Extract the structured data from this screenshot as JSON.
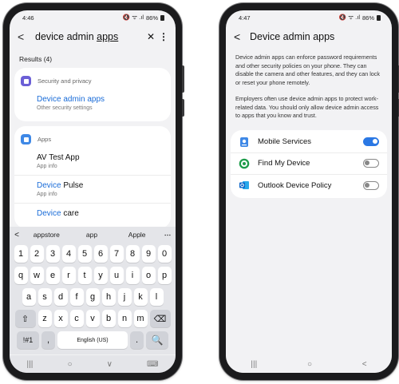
{
  "left": {
    "status": {
      "time": "4:46",
      "icons": "🔇 ᯤ .ıl",
      "battery": "86%"
    },
    "search": {
      "query_prefix": "device admin ",
      "query_underlined": "apps",
      "back": "<",
      "clear": "✕",
      "more": "⋮"
    },
    "results_label": "Results (4)",
    "groups": [
      {
        "category": "Security and privacy",
        "icon": "shield-icon",
        "color": "#6b5fd6",
        "items": [
          {
            "highlight": "Device admin apps",
            "rest": "",
            "subtitle": "Other security settings"
          }
        ]
      },
      {
        "category": "Apps",
        "icon": "apps-grid-icon",
        "color": "#3e88e6",
        "items": [
          {
            "highlight": "",
            "rest": "AV Test App",
            "subtitle": "App info"
          },
          {
            "highlight": "Device",
            "rest": " Pulse",
            "subtitle": "App info"
          },
          {
            "highlight": "Device",
            "rest": " care",
            "subtitle": ""
          }
        ]
      }
    ],
    "suggestions": {
      "chevron": "<",
      "items": [
        "appstore",
        "app",
        "Apple"
      ],
      "more": "⋯"
    },
    "keyboard": {
      "row1": [
        "1",
        "2",
        "3",
        "4",
        "5",
        "6",
        "7",
        "8",
        "9",
        "0"
      ],
      "row2": [
        "q",
        "w",
        "e",
        "r",
        "t",
        "y",
        "u",
        "i",
        "o",
        "p"
      ],
      "row3": [
        "a",
        "s",
        "d",
        "f",
        "g",
        "h",
        "j",
        "k",
        "l"
      ],
      "row4": [
        "⇧",
        "z",
        "x",
        "c",
        "v",
        "b",
        "n",
        "m",
        "⌫"
      ],
      "row5": [
        "!#1",
        ",",
        "English (US)",
        ".",
        "🔍"
      ]
    },
    "navbar": [
      "|||",
      "○",
      "∨",
      "⌨"
    ]
  },
  "right": {
    "status": {
      "time": "4:47",
      "icons": "🔇 ᯤ .ıl",
      "battery": "86%"
    },
    "header": {
      "back": "<",
      "title": "Device admin apps"
    },
    "para1": "Device admin apps can enforce password requirements and other security policies on your phone. They can disable the camera and other features, and they can lock or reset your phone remotely.",
    "para2": "Employers often use device admin apps to protect work-related data. You should only allow device admin access to apps that you know and trust.",
    "apps": [
      {
        "label": "Mobile Services",
        "icon": "mobile-services-icon",
        "enabled": true
      },
      {
        "label": "Find My Device",
        "icon": "find-my-device-icon",
        "enabled": false
      },
      {
        "label": "Outlook Device Policy",
        "icon": "outlook-icon",
        "enabled": false
      }
    ],
    "navbar": [
      "|||",
      "○",
      "<"
    ]
  },
  "colors": {
    "accent": "#2b78e4",
    "highlight_text": "#1a6cd8",
    "security_purple": "#6b5fd6"
  }
}
